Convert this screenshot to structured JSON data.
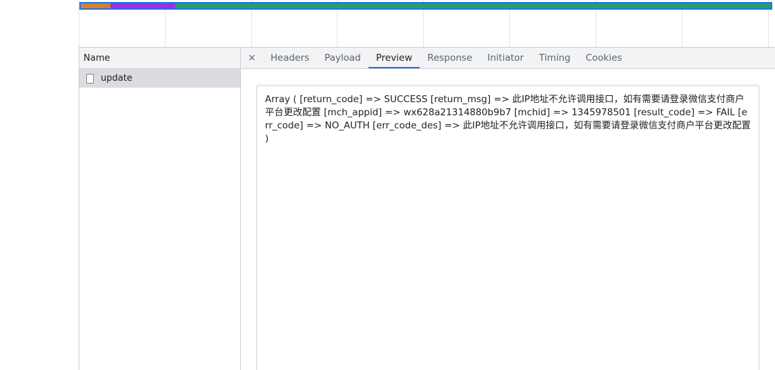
{
  "timeline": {
    "colors": {
      "queue": "#d97f2b",
      "request": "#9b30e0",
      "download": "#2a9d6a",
      "selection": "#1a73e8"
    }
  },
  "request_list": {
    "header": "Name",
    "items": [
      {
        "name": "update",
        "icon": "document-icon",
        "selected": true
      }
    ]
  },
  "detail": {
    "close_glyph": "×",
    "tabs": [
      {
        "label": "Headers",
        "active": false
      },
      {
        "label": "Payload",
        "active": false
      },
      {
        "label": "Preview",
        "active": true
      },
      {
        "label": "Response",
        "active": false
      },
      {
        "label": "Initiator",
        "active": false
      },
      {
        "label": "Timing",
        "active": false
      },
      {
        "label": "Cookies",
        "active": false
      }
    ],
    "preview_text": "Array ( [return_code] => SUCCESS [return_msg] => 此IP地址不允许调用接口，如有需要请登录微信支付商户平台更改配置 [mch_appid] => wx628a21314880b9b7 [mchid] => 1345978501 [result_code] => FAIL [err_code] => NO_AUTH [err_code_des] => 此IP地址不允许调用接口，如有需要请登录微信支付商户平台更改配置 )"
  }
}
